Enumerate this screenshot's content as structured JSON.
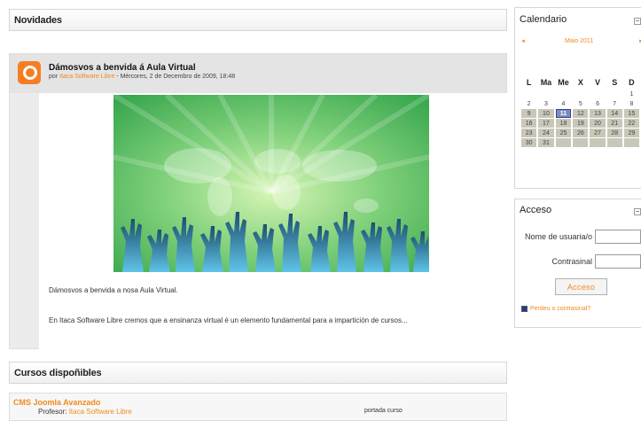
{
  "news": {
    "header": "Novidades",
    "post": {
      "title": "Dámosvos a benvida á Aula Virtual",
      "by_prefix": "por",
      "author": "Itaca Software Libre",
      "date": "- Mércores, 2 de Decembro de 2009, 18:48",
      "paragraph1": "Dámosvos a benvida a nosa Aula Virtual.",
      "paragraph2": "En Itaca Software Libre cremos que a ensinanza virtual é un elemento fundamental para a impartición de cursos..."
    }
  },
  "courses": {
    "header": "Cursos dispoñibles",
    "items": [
      {
        "title": "CMS Joomla Avanzado",
        "professor_label": "Profesor:",
        "professor": "Itaca Software Libre",
        "summary": "portada curso"
      }
    ]
  },
  "calendar": {
    "header": "Calendario",
    "collapse_symbol": "−",
    "prev_symbol": "◄",
    "next_symbol": "►",
    "month": "Maio 2011",
    "weekdays": [
      "L",
      "Ma",
      "Me",
      "X",
      "V",
      "S",
      "D"
    ],
    "weeks": [
      [
        "",
        "",
        "",
        "",
        "",
        "",
        "1"
      ],
      [
        "2",
        "3",
        "4",
        "5",
        "6",
        "7",
        "8"
      ],
      [
        "9",
        "10",
        "11",
        "12",
        "13",
        "14",
        "15"
      ],
      [
        "16",
        "17",
        "18",
        "19",
        "20",
        "21",
        "22"
      ],
      [
        "23",
        "24",
        "25",
        "26",
        "27",
        "28",
        "29"
      ],
      [
        "30",
        "31",
        "",
        "",
        "",
        "",
        ""
      ]
    ],
    "today": "11"
  },
  "access": {
    "header": "Acceso",
    "collapse_symbol": "−",
    "username_label": "Nome de usuaria/o",
    "password_label": "Contrasinal",
    "button_label": "Acceso",
    "forgot_label": "Perdeu o contrasinal?"
  },
  "colors": {
    "accent": "#f08a1c",
    "today": "#7b8cc2",
    "past_day": "#c9c7b8"
  }
}
